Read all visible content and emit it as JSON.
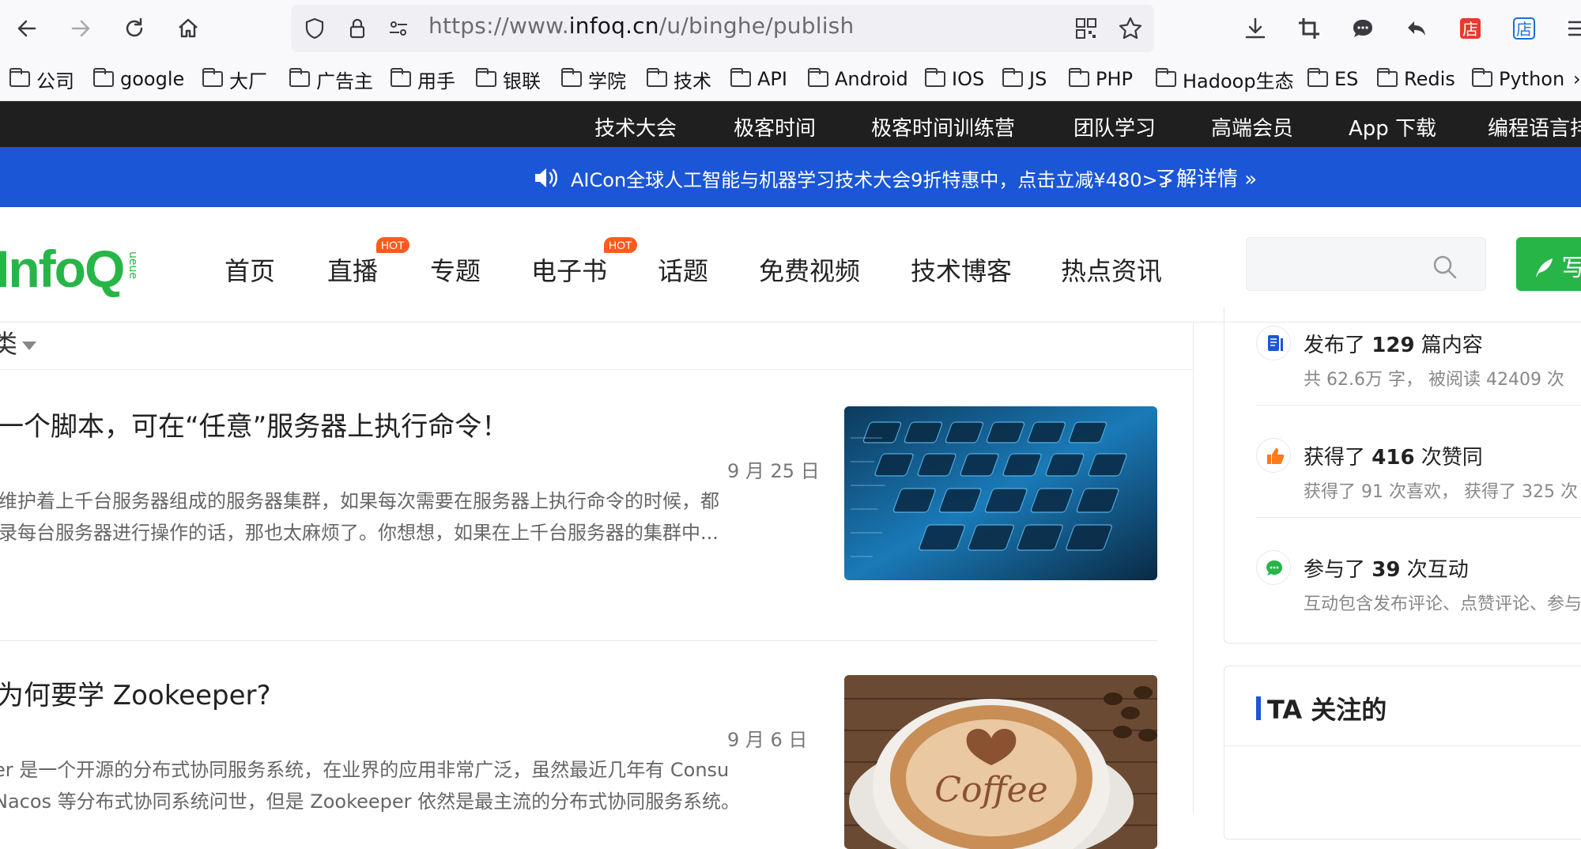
{
  "browser": {
    "url_prefix": "https://www.",
    "url_domain": "infoq.cn",
    "url_path": "/u/binghe/publish",
    "icons": [
      "back-icon",
      "forward-icon",
      "reload-icon",
      "home-icon",
      "shield-icon",
      "lock-icon",
      "permissions-icon",
      "qr-code-icon",
      "star-icon",
      "download-icon",
      "crop-icon",
      "chat-icon",
      "undo-icon",
      "store-icon",
      "menu-icon"
    ]
  },
  "bookmarks": [
    "公司",
    "google",
    "大厂",
    "广告主",
    "用手",
    "银联",
    "学院",
    "技术",
    "API",
    "Android",
    "IOS",
    "JS",
    "PHP",
    "Hadoop生态",
    "ES",
    "Redis",
    "Python"
  ],
  "topnav": [
    "技术大会",
    "极客时间",
    "极客时间训练营",
    "团队学习",
    "高端会员",
    "App 下载",
    "编程语言排"
  ],
  "banner": {
    "text": "AICon全球人工智能与机器学习技术大会9折特惠中，点击立减¥480>>",
    "more": "了解详情 »"
  },
  "header": {
    "logo": "InfoQ",
    "logo_sub": "ueue",
    "nav": [
      "首页",
      "直播",
      "专题",
      "电子书",
      "话题",
      "免费视频",
      "技术博客",
      "热点资讯"
    ],
    "hot_badge": "HOT",
    "write_button": "写"
  },
  "category": {
    "label": "类"
  },
  "articles": [
    {
      "title": "一个脚本，可在“任意”服务器上执行命令！",
      "date": "9 月 25 日",
      "summary_1": "维护着上千台服务器组成的服务器集群，如果每次需要在服务器上执行命令的时候，都",
      "summary_2": "录每台服务器进行操作的话，那也太麻烦了。你想想，如果在上千台服务器的集群中..."
    },
    {
      "title": "为何要学 Zookeeper?",
      "date": "9 月 6 日",
      "summary_1": "er 是一个开源的分布式协同服务系统，在业界的应用非常广泛，虽然最近几年有 Consu",
      "summary_2": "Nacos 等分布式协同系统问世，但是 Zookeeper 依然是最主流的分布式协同服务系统。"
    }
  ],
  "sidebar": {
    "stats": [
      {
        "main_pre": "发布了 ",
        "num": "129",
        "main_post": " 篇内容",
        "sub": "共 62.6万 字， 被阅读 42409 次",
        "color": "#1a56d6"
      },
      {
        "main_pre": "获得了 ",
        "num": "416",
        "main_post": " 次赞同",
        "sub": "获得了 91 次喜欢， 获得了 325 次",
        "color": "#ff7a1a"
      },
      {
        "main_pre": "参与了 ",
        "num": "39",
        "main_post": " 次互动",
        "sub": "互动包含发布评论、点赞评论、参与",
        "color": "#27b548"
      }
    ],
    "follow_title": "TA 关注的"
  }
}
